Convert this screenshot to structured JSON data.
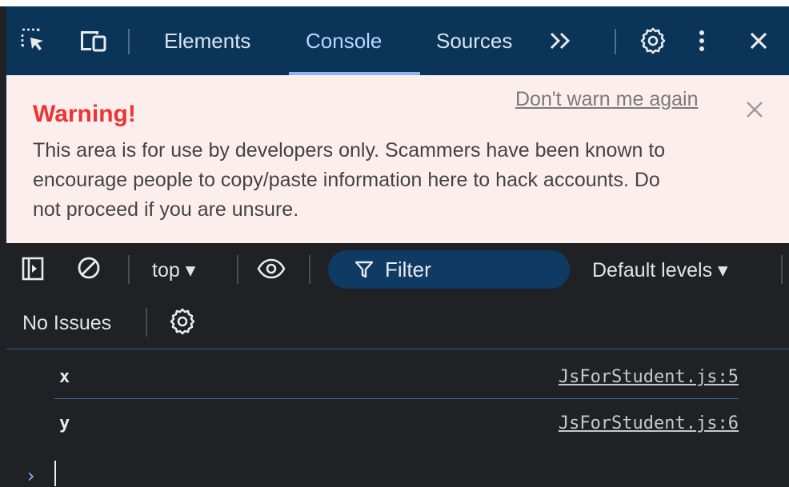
{
  "devtools": {
    "tabs": [
      {
        "label": "Elements",
        "active": false
      },
      {
        "label": "Console",
        "active": true
      },
      {
        "label": "Sources",
        "active": false
      }
    ],
    "more_tabs": "»",
    "accent_color": "#8ab4f8"
  },
  "warning": {
    "title": "Warning!",
    "dont_warn": "Don't warn me again",
    "body_lines": [
      "This area is for use by developers only. Scammers have been known to",
      "encourage people to copy/paste information here to hack accounts. Do",
      "not proceed if you are unsure."
    ]
  },
  "console_toolbar": {
    "context": "top ▾",
    "filter_label": "Filter",
    "levels": "Default levels ▾",
    "issues": "No Issues"
  },
  "messages": [
    {
      "text": "x",
      "source": "JsForStudent.js:5"
    },
    {
      "text": "y",
      "source": "JsForStudent.js:6"
    }
  ],
  "prompt": {
    "symbol": "›"
  }
}
